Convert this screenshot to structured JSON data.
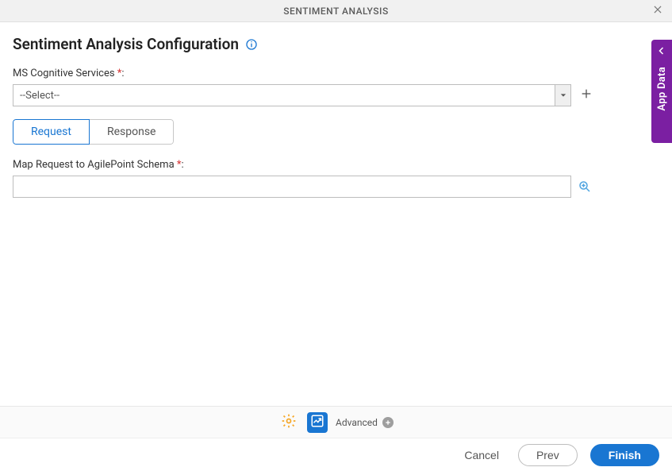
{
  "window": {
    "title": "SENTIMENT ANALYSIS"
  },
  "page": {
    "title": "Sentiment Analysis Configuration"
  },
  "form": {
    "cognitive_label": "MS Cognitive Services ",
    "cognitive_required_marker": "*",
    "cognitive_colon": ":",
    "cognitive_selected": "--Select--"
  },
  "tabs": {
    "request": "Request",
    "response": "Response"
  },
  "map": {
    "label": "Map Request to AgilePoint Schema ",
    "required_marker": "*",
    "colon": ":",
    "value": ""
  },
  "side": {
    "label": "App Data"
  },
  "advanced": {
    "label": "Advanced"
  },
  "footer": {
    "cancel": "Cancel",
    "prev": "Prev",
    "finish": "Finish"
  }
}
